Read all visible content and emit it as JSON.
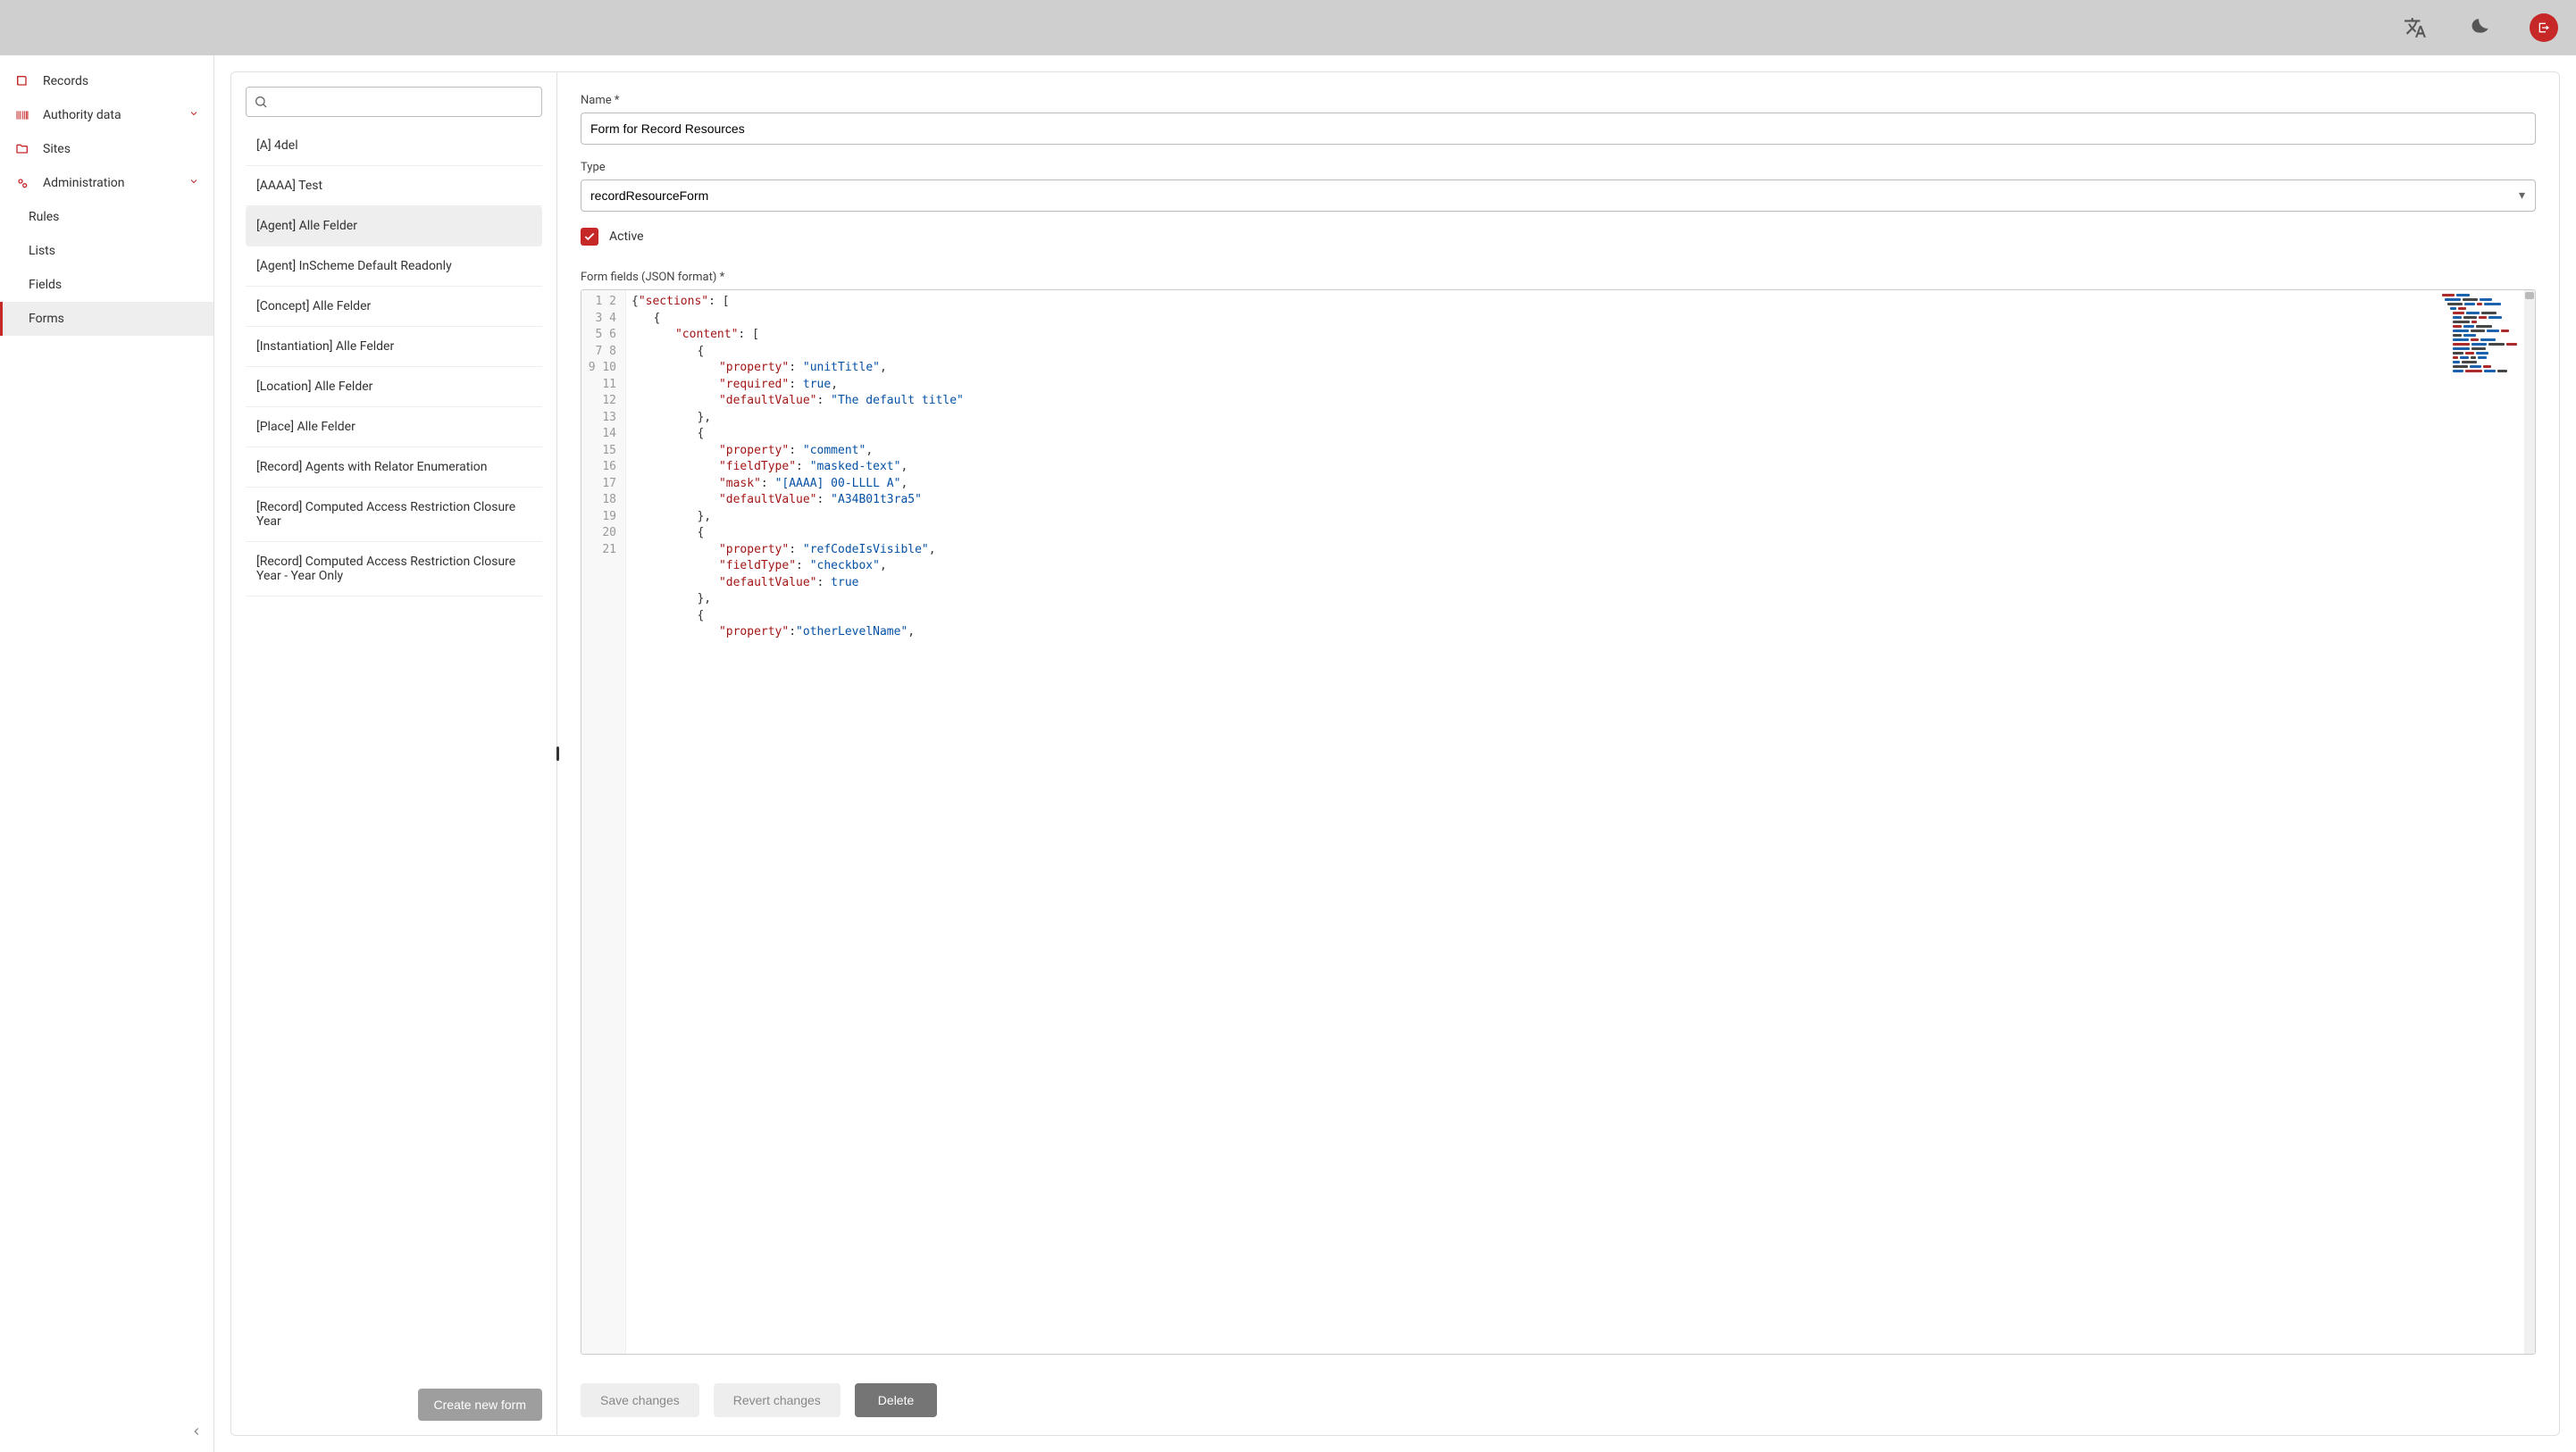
{
  "topbar": {
    "lang_icon": "language-icon",
    "dark_icon": "dark-mode-icon",
    "user_icon": "logout-arrow"
  },
  "sidebar": {
    "items": [
      {
        "label": "Records",
        "icon": "book"
      },
      {
        "label": "Authority data",
        "icon": "barcode",
        "expandable": true
      },
      {
        "label": "Sites",
        "icon": "folder"
      },
      {
        "label": "Administration",
        "icon": "gears",
        "expandable": true
      }
    ],
    "sub_items": [
      {
        "label": "Rules"
      },
      {
        "label": "Lists"
      },
      {
        "label": "Fields"
      },
      {
        "label": "Forms",
        "active": true
      }
    ]
  },
  "list": {
    "search_placeholder": "",
    "items": [
      {
        "label": "[A] 4del"
      },
      {
        "label": "[AAAA] Test"
      },
      {
        "label": "[Agent] Alle Felder",
        "selected": true
      },
      {
        "label": "[Agent] InScheme Default Readonly"
      },
      {
        "label": "[Concept] Alle Felder"
      },
      {
        "label": "[Instantiation] Alle Felder"
      },
      {
        "label": "[Location] Alle Felder"
      },
      {
        "label": "[Place] Alle Felder"
      },
      {
        "label": "[Record] Agents with Relator Enumeration"
      },
      {
        "label": "[Record] Computed Access Restriction Closure Year"
      },
      {
        "label": "[Record] Computed Access Restriction Closure Year - Year Only"
      }
    ],
    "create_btn": "Create new form"
  },
  "detail": {
    "name_label": "Name *",
    "name_value": "Form for Record Resources",
    "type_label": "Type",
    "type_value": "recordResourceForm",
    "active_label": "Active",
    "active_checked": true,
    "json_label": "Form fields (JSON format) *",
    "buttons": {
      "save": "Save changes",
      "revert": "Revert changes",
      "delete": "Delete"
    }
  },
  "code": {
    "line_count": 21,
    "lines": [
      {
        "indent": 0,
        "tokens": [
          {
            "t": "brace",
            "v": "{"
          },
          {
            "t": "key",
            "v": "\"sections\""
          },
          {
            "t": "punct",
            "v": ": "
          },
          {
            "t": "brace",
            "v": "["
          }
        ]
      },
      {
        "indent": 1,
        "tokens": [
          {
            "t": "brace",
            "v": "{"
          }
        ]
      },
      {
        "indent": 2,
        "tokens": [
          {
            "t": "key",
            "v": "\"content\""
          },
          {
            "t": "punct",
            "v": ": "
          },
          {
            "t": "brace",
            "v": "["
          }
        ]
      },
      {
        "indent": 3,
        "tokens": [
          {
            "t": "brace",
            "v": "{"
          }
        ]
      },
      {
        "indent": 4,
        "tokens": [
          {
            "t": "key",
            "v": "\"property\""
          },
          {
            "t": "punct",
            "v": ": "
          },
          {
            "t": "str",
            "v": "\"unitTitle\""
          },
          {
            "t": "punct",
            "v": ","
          }
        ]
      },
      {
        "indent": 4,
        "tokens": [
          {
            "t": "key",
            "v": "\"required\""
          },
          {
            "t": "punct",
            "v": ": "
          },
          {
            "t": "bool",
            "v": "true"
          },
          {
            "t": "punct",
            "v": ","
          }
        ]
      },
      {
        "indent": 4,
        "tokens": [
          {
            "t": "key",
            "v": "\"defaultValue\""
          },
          {
            "t": "punct",
            "v": ": "
          },
          {
            "t": "str",
            "v": "\"The default title\""
          }
        ]
      },
      {
        "indent": 3,
        "tokens": [
          {
            "t": "brace",
            "v": "}"
          },
          {
            "t": "punct",
            "v": ","
          }
        ]
      },
      {
        "indent": 3,
        "tokens": [
          {
            "t": "brace",
            "v": "{"
          }
        ]
      },
      {
        "indent": 4,
        "tokens": [
          {
            "t": "key",
            "v": "\"property\""
          },
          {
            "t": "punct",
            "v": ": "
          },
          {
            "t": "str",
            "v": "\"comment\""
          },
          {
            "t": "punct",
            "v": ","
          }
        ]
      },
      {
        "indent": 4,
        "tokens": [
          {
            "t": "key",
            "v": "\"fieldType\""
          },
          {
            "t": "punct",
            "v": ": "
          },
          {
            "t": "str",
            "v": "\"masked-text\""
          },
          {
            "t": "punct",
            "v": ","
          }
        ]
      },
      {
        "indent": 4,
        "tokens": [
          {
            "t": "key",
            "v": "\"mask\""
          },
          {
            "t": "punct",
            "v": ": "
          },
          {
            "t": "str",
            "v": "\"[AAAA] 00-LLLL A\""
          },
          {
            "t": "punct",
            "v": ","
          }
        ]
      },
      {
        "indent": 4,
        "tokens": [
          {
            "t": "key",
            "v": "\"defaultValue\""
          },
          {
            "t": "punct",
            "v": ": "
          },
          {
            "t": "str",
            "v": "\"A34B01t3ra5\""
          }
        ]
      },
      {
        "indent": 3,
        "tokens": [
          {
            "t": "brace",
            "v": "}"
          },
          {
            "t": "punct",
            "v": ","
          }
        ]
      },
      {
        "indent": 3,
        "tokens": [
          {
            "t": "brace",
            "v": "{"
          }
        ]
      },
      {
        "indent": 4,
        "tokens": [
          {
            "t": "key",
            "v": "\"property\""
          },
          {
            "t": "punct",
            "v": ": "
          },
          {
            "t": "str",
            "v": "\"refCodeIsVisible\""
          },
          {
            "t": "punct",
            "v": ","
          }
        ]
      },
      {
        "indent": 4,
        "tokens": [
          {
            "t": "key",
            "v": "\"fieldType\""
          },
          {
            "t": "punct",
            "v": ": "
          },
          {
            "t": "str",
            "v": "\"checkbox\""
          },
          {
            "t": "punct",
            "v": ","
          }
        ]
      },
      {
        "indent": 4,
        "tokens": [
          {
            "t": "key",
            "v": "\"defaultValue\""
          },
          {
            "t": "punct",
            "v": ": "
          },
          {
            "t": "bool",
            "v": "true"
          }
        ]
      },
      {
        "indent": 3,
        "tokens": [
          {
            "t": "brace",
            "v": "}"
          },
          {
            "t": "punct",
            "v": ","
          }
        ]
      },
      {
        "indent": 3,
        "tokens": [
          {
            "t": "brace",
            "v": "{"
          }
        ]
      },
      {
        "indent": 4,
        "tokens": [
          {
            "t": "key",
            "v": "\"property\""
          },
          {
            "t": "punct",
            "v": ":"
          },
          {
            "t": "str",
            "v": "\"otherLevelName\""
          },
          {
            "t": "punct",
            "v": ","
          }
        ]
      }
    ]
  }
}
